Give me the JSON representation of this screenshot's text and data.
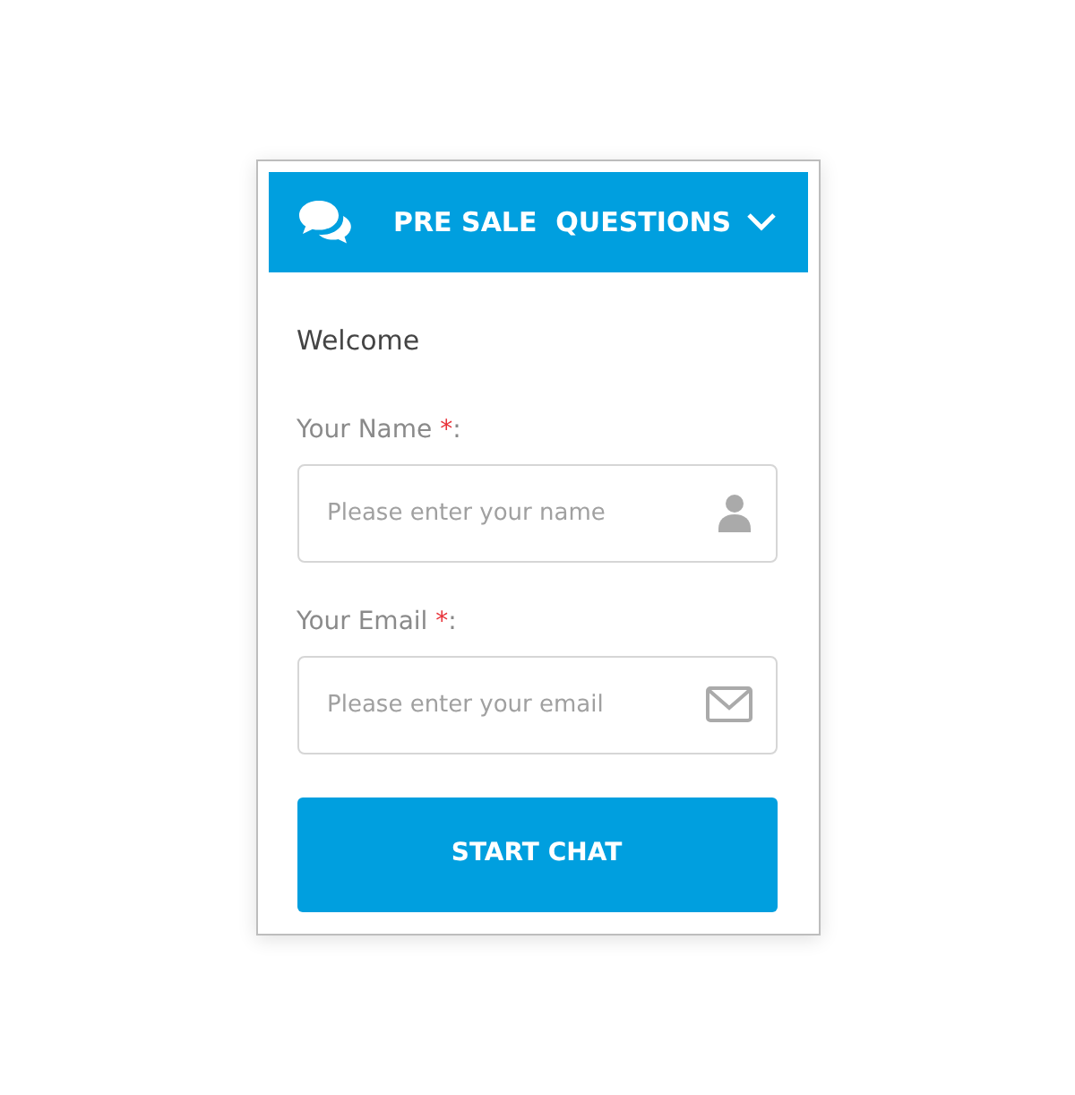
{
  "header": {
    "title": "PRE SALE  QUESTIONS",
    "expanded": true
  },
  "welcome": "Welcome",
  "fields": [
    {
      "kind": "name",
      "label": "Your Name",
      "required_mark": "*",
      "suffix": ":",
      "placeholder": "Please enter your name"
    },
    {
      "kind": "email",
      "label": "Your Email",
      "required_mark": "*",
      "suffix": ":",
      "placeholder": "Please enter your email"
    }
  ],
  "button": "START CHAT"
}
